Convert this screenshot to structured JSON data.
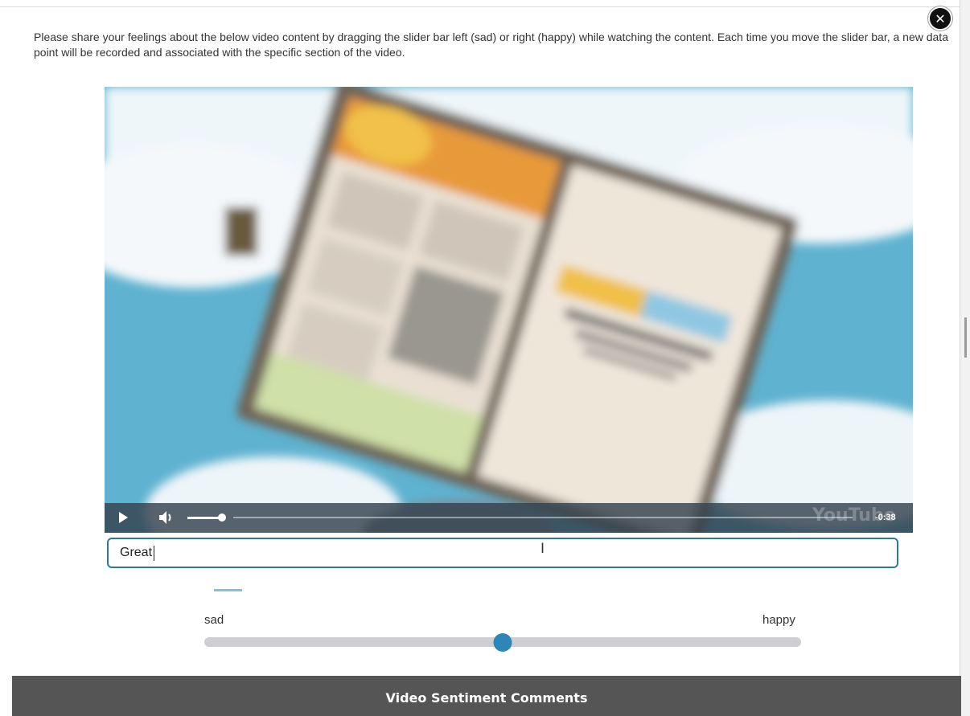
{
  "instructions": "Please share your feelings about the below video content by dragging the slider bar left (sad) or right (happy) while watching the content. Each time you move the slider bar, a new data point will be recorded and associated with the specific section of the video.",
  "video": {
    "time_remaining": "-0:38",
    "watermark": "YouTube",
    "volume_level": 0.9,
    "progress": 0.0
  },
  "comment": {
    "value": "Great"
  },
  "slider": {
    "left_label": "sad",
    "right_label": "happy",
    "value": 0.5
  },
  "footer": {
    "title": "Video Sentiment Comments"
  },
  "colors": {
    "accent": "#2e86b8",
    "footer_bg": "#555555",
    "track": "#cfcfd3"
  },
  "icons": [
    "close-icon",
    "play-icon",
    "volume-icon",
    "text-cursor-icon"
  ]
}
